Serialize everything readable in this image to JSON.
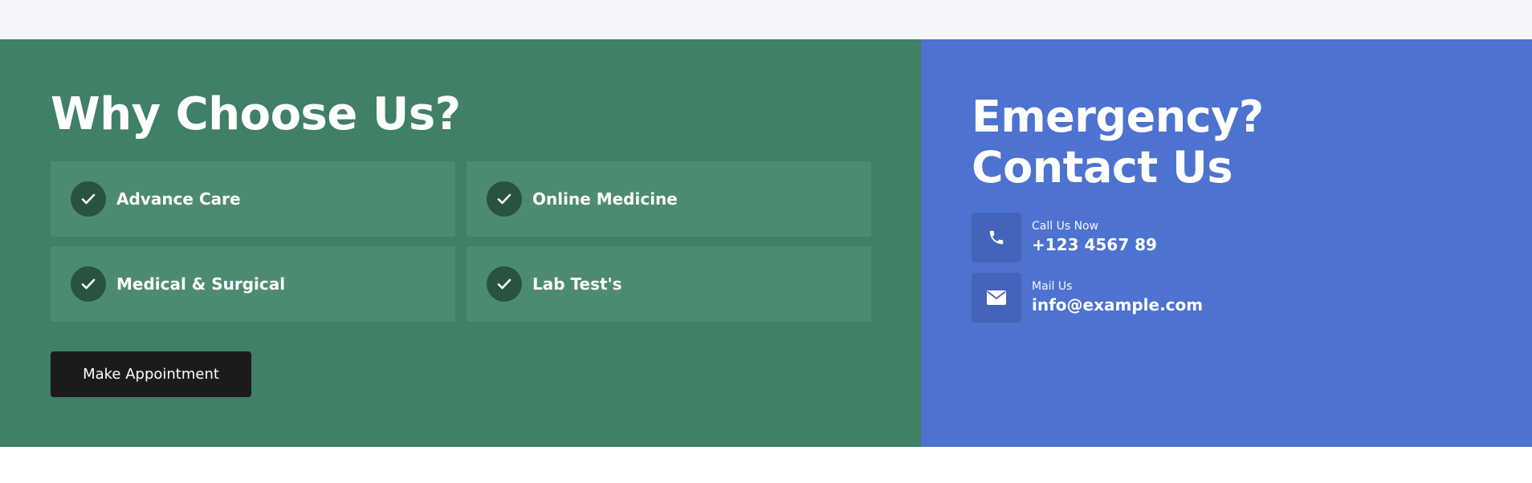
{
  "colors": {
    "page_background_top": "#f5f6fb",
    "why_background": "#3f8066",
    "feature_background": "#4c8b71",
    "check_circle": "#285340",
    "emergency_background": "#4d72cf",
    "contact_icon_background": "#4464bb",
    "button_background": "#1b1b1b",
    "text": "#ffffff"
  },
  "why_choose": {
    "title": "Why Choose Us?",
    "features": [
      {
        "label": "Advance Care",
        "icon": "check-icon"
      },
      {
        "label": "Online Medicine",
        "icon": "check-icon"
      },
      {
        "label": "Medical & Surgical",
        "icon": "check-icon"
      },
      {
        "label": "Lab Test's",
        "icon": "check-icon"
      }
    ],
    "button_label": "Make Appointment"
  },
  "emergency": {
    "title_line1": "Emergency?",
    "title_line2": "Contact Us",
    "contacts": [
      {
        "label": "Call Us Now",
        "value": "+123 4567 89",
        "icon": "phone-icon"
      },
      {
        "label": "Mail Us",
        "value": "info@example.com",
        "icon": "envelope-icon"
      }
    ]
  }
}
